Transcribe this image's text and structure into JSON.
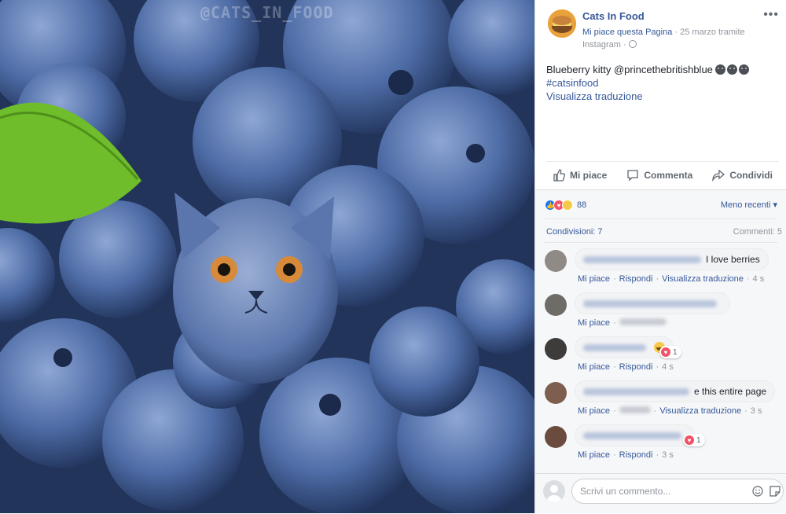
{
  "photo": {
    "watermark": "@CATS_IN_FOOD",
    "description_colors": {
      "berry": "#3f5d93",
      "leaf": "#6fbd2b"
    }
  },
  "post": {
    "page_name": "Cats In Food",
    "like_page": "Mi piace questa Pagina",
    "date": "· 25 marzo tramite",
    "source": "Instagram ·",
    "caption": "Blueberry kitty @princethebritishblue",
    "hashtag": "#catsinfood",
    "translate": "Visualizza traduzione"
  },
  "actions": {
    "like": "Mi piace",
    "comment": "Commenta",
    "share": "Condividi"
  },
  "reactions": {
    "count": "88",
    "sort": "Meno recenti ▾",
    "shares": "Condivisioni: 7",
    "comments": "Commenti: 5"
  },
  "comments": [
    {
      "text": "I love berries",
      "like": "Mi piace",
      "reply": "Rispondi",
      "translate": "Visualizza traduzione",
      "time": "4 s"
    },
    {
      "text": "",
      "like": "Mi piace",
      "reply": "",
      "translate": "",
      "time": ""
    },
    {
      "text": "",
      "like": "Mi piace",
      "reply": "Rispondi",
      "translate": "",
      "time": "4 s",
      "reaction_count": "1"
    },
    {
      "text": "e this entire page",
      "like": "Mi piace",
      "reply": "",
      "translate": "Visualizza traduzione",
      "time": "3 s"
    },
    {
      "text": "",
      "like": "Mi piace",
      "reply": "Rispondi",
      "translate": "",
      "time": "3 s",
      "reaction_count": "1"
    }
  ],
  "composer": {
    "placeholder": "Scrivi un commento..."
  }
}
